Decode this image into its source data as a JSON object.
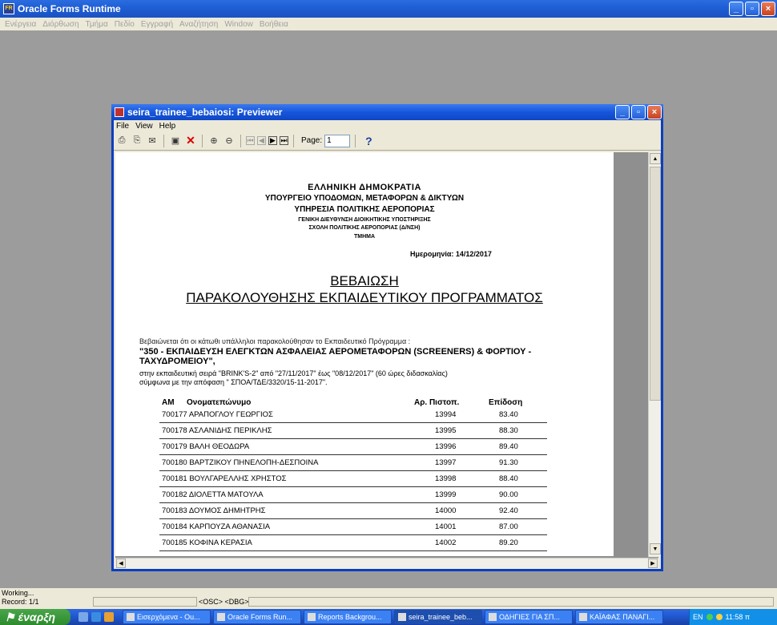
{
  "app": {
    "title": "Oracle Forms Runtime",
    "menu": [
      "Ενέργεια",
      "Διόρθωση",
      "Τμήμα",
      "Πεδίο",
      "Εγγραφή",
      "Αναζήτηση",
      "Window",
      "Βοήθεια"
    ]
  },
  "previewer": {
    "title": "seira_trainee_bebaiosi: Previewer",
    "menu": [
      "File",
      "View",
      "Help"
    ],
    "page_label": "Page:",
    "page_value": "1"
  },
  "doc": {
    "header": [
      "ΕΛΛΗΝΙΚΗ ΔΗΜΟΚΡΑΤΙΑ",
      "ΥΠΟΥΡΓΕΙΟ ΥΠΟΔΟΜΩΝ, ΜΕΤΑΦΟΡΩΝ & ΔΙΚΤΥΩΝ",
      "ΥΠΗΡΕΣΙΑ ΠΟΛΙΤΙΚΗΣ ΑΕΡΟΠΟΡΙΑΣ",
      "ΓΕΝΙΚΗ ΔΙΕΥΘΥΝΣΗ ΔΙΟΙΚΗΤΙΚΗΣ ΥΠΟΣΤΗΡΙΞΗΣ",
      "ΣΧΟΛΗ ΠΟΛΙΤΙΚΗΣ ΑΕΡΟΠΟΡΙΑΣ (Δ/ΝΣΗ)",
      "ΤΜΗΜΑ"
    ],
    "date": "Ημερομηνία: 14/12/2017",
    "title_line1": "ΒΕΒΑΙΩΣΗ",
    "title_line2": "ΠΑΡΑΚΟΛΟΥΘΗΣΗΣ ΕΚΠΑΙΔΕΥΤΙΚΟΥ ΠΡΟΓΡΑΜΜΑΤΟΣ",
    "intro": "Βεβαιώνεται ότι οι κάτωθι υπάλληλοι παρακολούθησαν το Εκπαιδευτικό Πρόγραμμα :",
    "program": "\"350 - ΕΚΠΑΙΔΕΥΣΗ ΕΛΕΓΚΤΩΝ ΑΣΦΑΛΕΙΑΣ ΑΕΡΟΜΕΤΑΦΟΡΩΝ (SCREENERS) & ΦΟΡΤΙΟΥ - ΤΑΧΥΔΡΟΜΕΙΟΥ\",",
    "series_line": "στην εκπαιδευτική σειρά \"BRINK'S-2\" από \"27/11/2017\" έως \"08/12/2017\" (60 ώρες διδασκαλίας)",
    "decision_line": "σύμφωνα με την απόφαση \" ΣΠΟΑ/ΤΔΕ/3320/15-11-2017\".",
    "columns": {
      "am": "ΑΜ",
      "name": "Ονοματεπώνυμο",
      "cert": "Αρ. Πιστοπ.",
      "score": "Επίδοση"
    },
    "rows": [
      {
        "name": "700177 ΑΡΑΠΟΓΛΟΥ ΓΕΩΡΓΙΟΣ",
        "cert": "13994",
        "score": "83.40"
      },
      {
        "name": "700178 ΑΣΛΑΝΙΔΗΣ ΠΕΡΙΚΛΗΣ",
        "cert": "13995",
        "score": "88.30"
      },
      {
        "name": "700179 ΒΑΛΗ ΘΕΟΔΩΡΑ",
        "cert": "13996",
        "score": "89.40"
      },
      {
        "name": "700180 ΒΑΡΤΖΙΚΟΥ ΠΗΝΕΛΟΠΗ-ΔΕΣΠΟΙΝΑ",
        "cert": "13997",
        "score": "91.30"
      },
      {
        "name": "700181 ΒΟΥΛΓΑΡΕΛΛΗΣ ΧΡΗΣΤΟΣ",
        "cert": "13998",
        "score": "88.40"
      },
      {
        "name": "700182 ΔΙΟΛΕΤΤΑ ΜΑΤΟΥΛΑ",
        "cert": "13999",
        "score": "90.00"
      },
      {
        "name": "700183 ΔΟΥΜΟΣ ΔΗΜΗΤΡΗΣ",
        "cert": "14000",
        "score": "92.40"
      },
      {
        "name": "700184 ΚΑΡΠΟΥΖΑ ΑΘΑΝΑΣΙΑ",
        "cert": "14001",
        "score": "87.00"
      },
      {
        "name": "700185 ΚΟΦΙΝΑ ΚΕΡΑΣΙΑ",
        "cert": "14002",
        "score": "89.20"
      }
    ]
  },
  "status": {
    "line1": "Working...",
    "line2": "Record: 1/1",
    "osc": "<OSC> <DBG>"
  },
  "taskbar": {
    "start": "έναρξη",
    "tasks": [
      {
        "label": "Εισερχόμενα - Ou...",
        "active": false
      },
      {
        "label": "Oracle Forms Run...",
        "active": false
      },
      {
        "label": "Reports Backgrou...",
        "active": false
      },
      {
        "label": "seira_trainee_beb...",
        "active": true
      },
      {
        "label": "ΟΔΗΓΙΕΣ ΓΙΑ ΣΠ...",
        "active": false
      },
      {
        "label": "ΚΑΪΑΦΑΣ ΠΑΝΑΓΙ...",
        "active": false
      }
    ],
    "lang": "EN",
    "clock": "11:58 π"
  }
}
